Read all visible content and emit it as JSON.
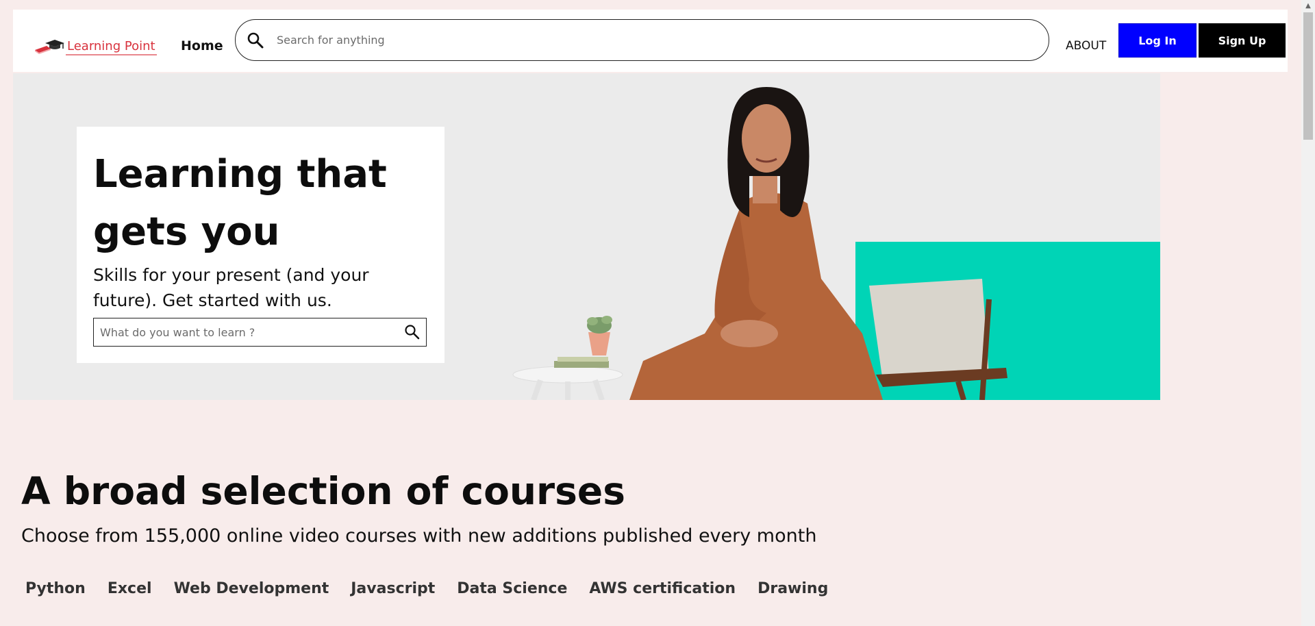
{
  "navbar": {
    "logo_text": "Learning Point",
    "home_label": "Home",
    "search_placeholder": "Search for anything",
    "about_label": "ABOUT",
    "login_label": "Log In",
    "signup_label": "Sign Up"
  },
  "hero": {
    "title": "Learning that gets you",
    "subtitle": "Skills for your present (and your future). Get started with us.",
    "search_placeholder": "What do you want to learn ?"
  },
  "courses": {
    "title": "A broad selection of courses",
    "subtitle": "Choose from 155,000 online video courses with new additions published every month",
    "tabs": [
      "Python",
      "Excel",
      "Web Development",
      "Javascript",
      "Data Science",
      "AWS certification",
      "Drawing"
    ]
  },
  "icons": {
    "logo": "graduation-cap-book-icon",
    "search": "search-icon",
    "scroll_up": "chevron-up-icon"
  },
  "colors": {
    "page_bg": "#f8eceb",
    "login_bg": "#0000ff",
    "signup_bg": "#000000",
    "hero_accent": "#00d4b6",
    "logo_red": "#d8323d"
  }
}
